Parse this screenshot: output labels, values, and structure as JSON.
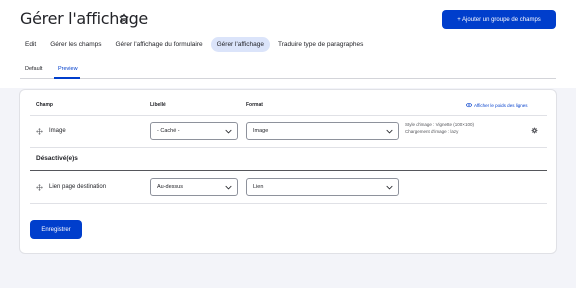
{
  "page": {
    "title": "Gérer l'affichage",
    "primary_action": "+ Ajouter un groupe de champs"
  },
  "tabs": [
    {
      "label": "Edit"
    },
    {
      "label": "Gérer les champs"
    },
    {
      "label": "Gérer l'affichage du formulaire"
    },
    {
      "label": "Gérer l'affichage",
      "active": true
    },
    {
      "label": "Traduire type de paragraphes"
    }
  ],
  "subtabs": [
    {
      "label": "Default"
    },
    {
      "label": "Preview",
      "active": true
    }
  ],
  "table": {
    "headers": {
      "field": "Champ",
      "label": "Libellé",
      "format": "Format"
    },
    "show_weights_link": "Afficher le poids des lignes",
    "rows": [
      {
        "field": "Image",
        "label_value": "- Caché -",
        "format_value": "Image",
        "summary_line1": "Style d'image : Vignette (100×100)",
        "summary_line2": "Chargement d'image : lazy"
      }
    ],
    "disabled_section_title": "Désactivé(e)s",
    "disabled_rows": [
      {
        "field": "Lien page destination",
        "label_value": "Au-dessus",
        "format_value": "Lien"
      }
    ]
  },
  "save_button": "Enregistrer",
  "colors": {
    "primary": "#003ecc",
    "tab_active_bg": "#dbe4fa",
    "background": "#f3f4f9"
  }
}
